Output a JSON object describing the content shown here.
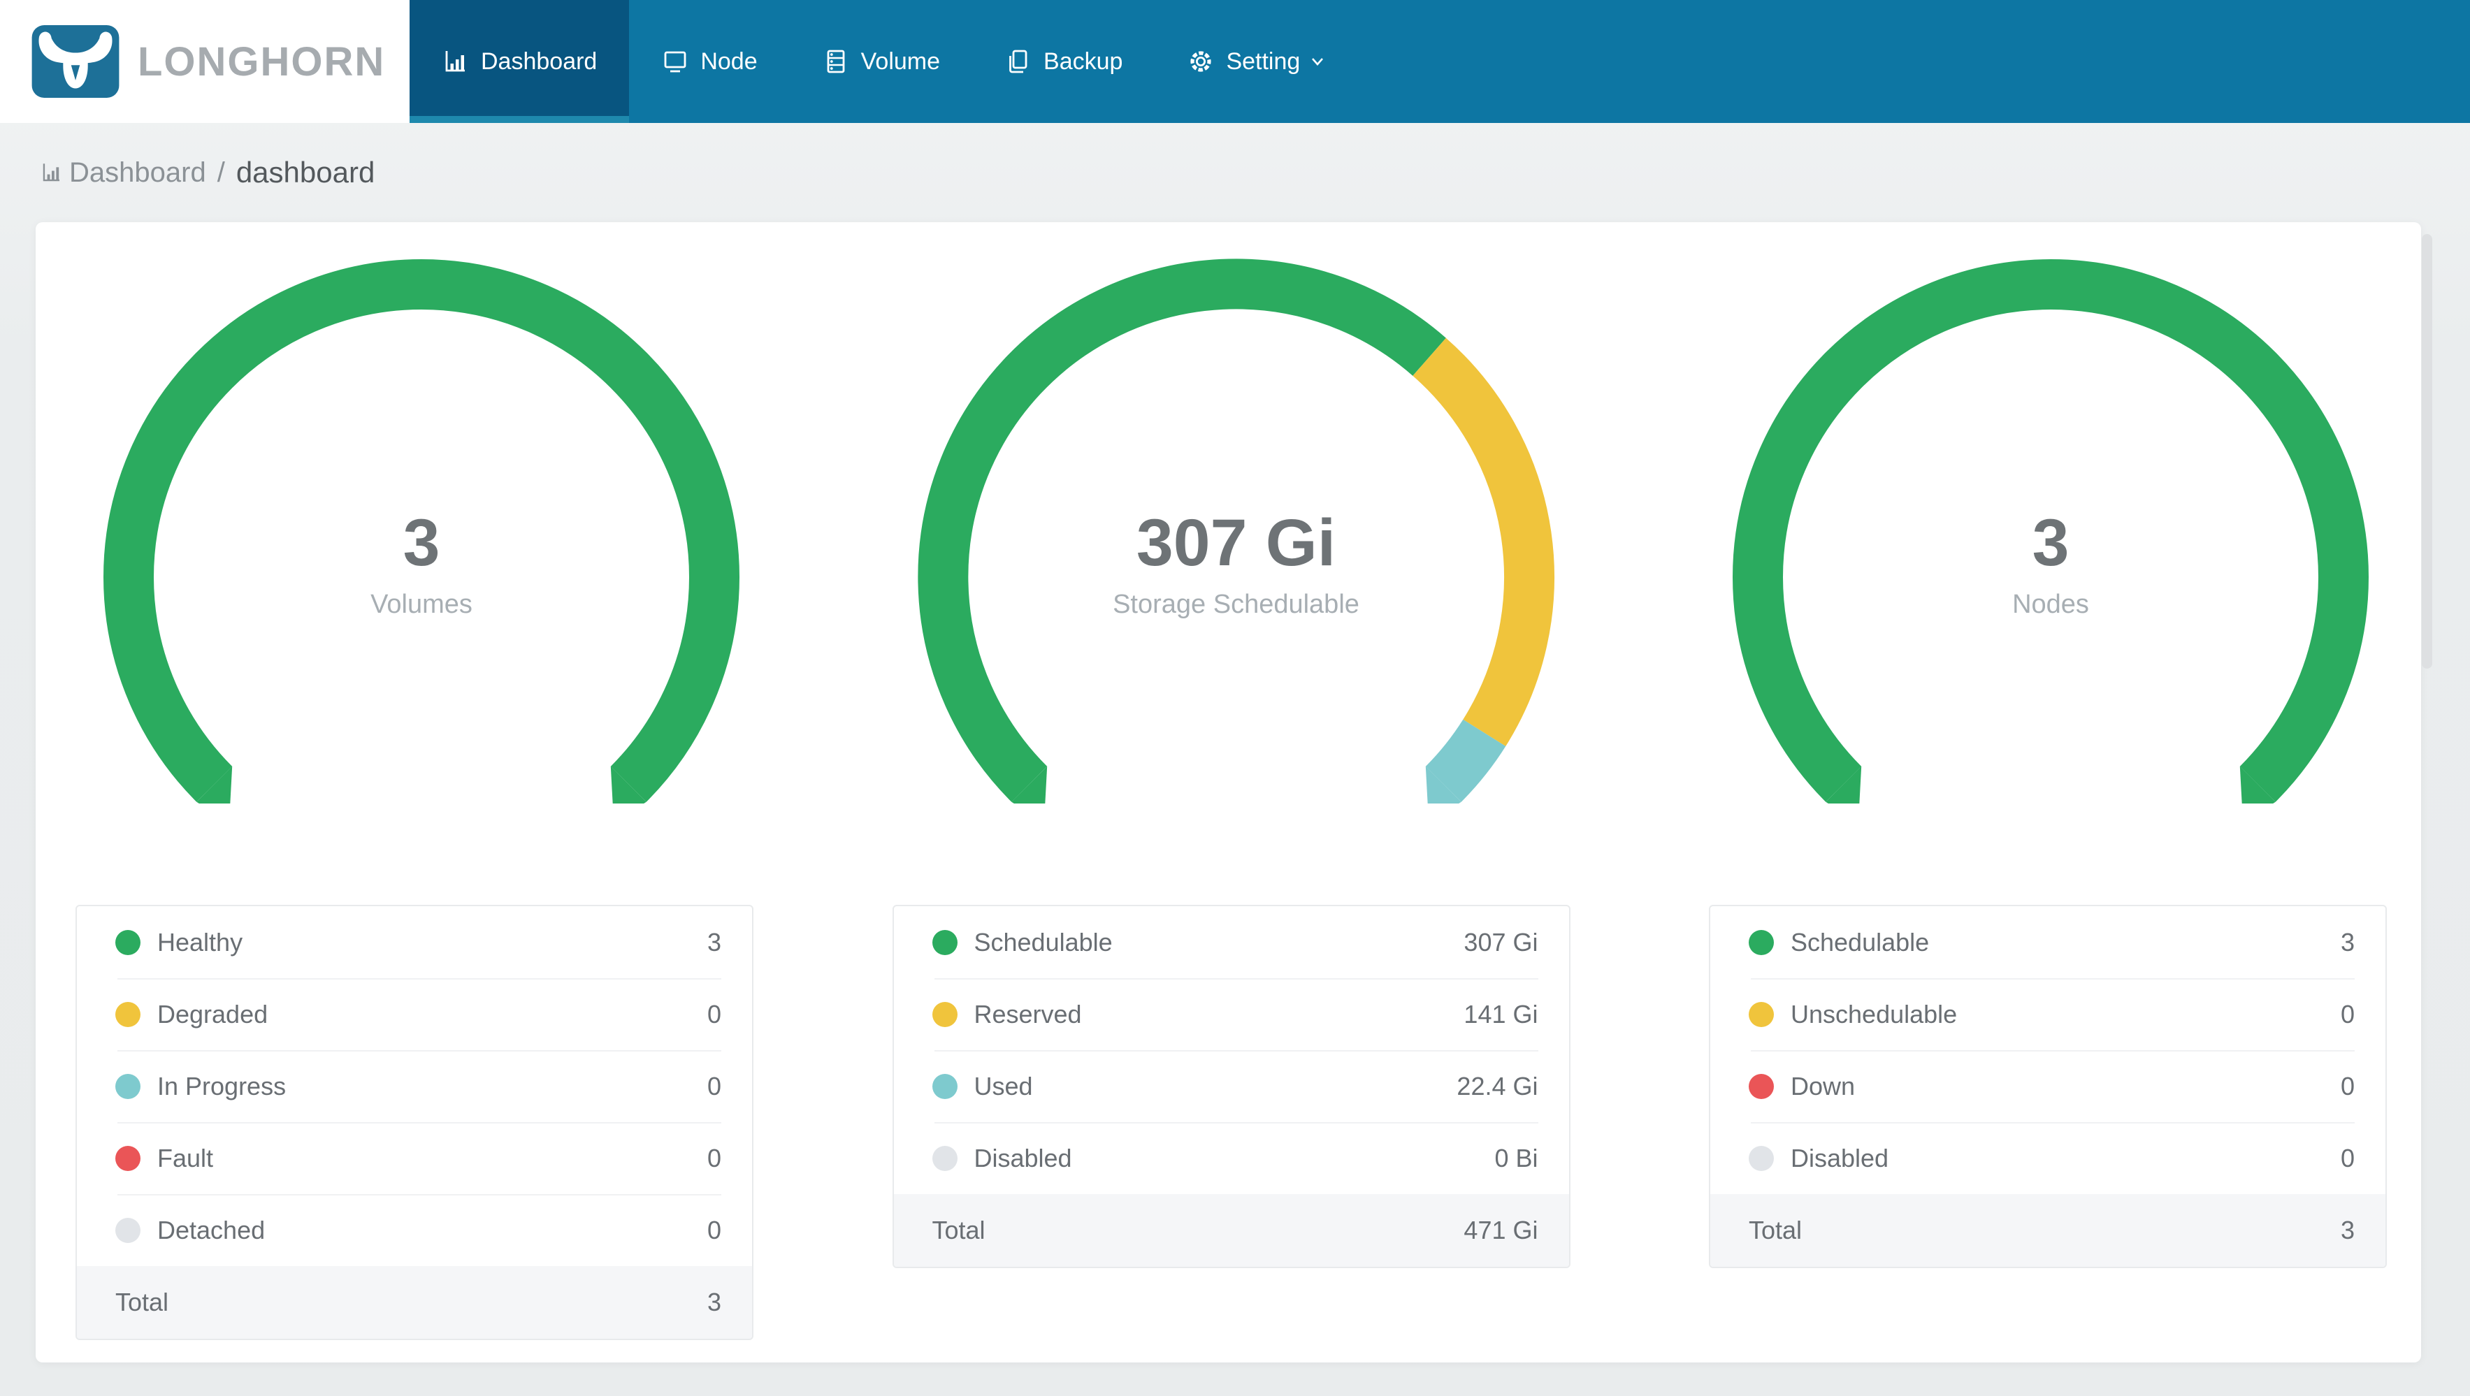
{
  "brand": {
    "name": "LONGHORN"
  },
  "nav": {
    "items": [
      {
        "label": "Dashboard",
        "icon": "bar-chart-icon",
        "active": true
      },
      {
        "label": "Node",
        "icon": "desktop-icon",
        "active": false
      },
      {
        "label": "Volume",
        "icon": "database-icon",
        "active": false
      },
      {
        "label": "Backup",
        "icon": "copy-icon",
        "active": false
      },
      {
        "label": "Setting",
        "icon": "gear-icon",
        "active": false,
        "has_dropdown": true
      }
    ]
  },
  "breadcrumb": {
    "icon": "bar-chart-icon",
    "section": "Dashboard",
    "separator": "/",
    "page": "dashboard"
  },
  "colors": {
    "navbar": "#0d76a3",
    "navbar_active": "#085580",
    "navbar_active_underline": "#1e89ad",
    "logo_blue": "#1d7098",
    "green": "#2bab5f",
    "yellow": "#f0c43c",
    "teal": "#7ecace",
    "red": "#ea5557",
    "gray_dot": "#e1e4e8"
  },
  "chart_data": [
    {
      "type": "gauge",
      "title": "Volumes",
      "center_value": "3",
      "center_label": "Volumes",
      "start_angle": -135,
      "end_angle": 135,
      "total": 3,
      "unit": "",
      "segments": [
        {
          "name": "Healthy",
          "value": 3,
          "color": "#2bab5f"
        },
        {
          "name": "Degraded",
          "value": 0,
          "color": "#f0c43c"
        },
        {
          "name": "In Progress",
          "value": 0,
          "color": "#7ecace"
        },
        {
          "name": "Fault",
          "value": 0,
          "color": "#ea5557"
        },
        {
          "name": "Detached",
          "value": 0,
          "color": "#e1e4e8"
        }
      ]
    },
    {
      "type": "gauge",
      "title": "Storage Schedulable",
      "center_value": "307 Gi",
      "center_label": "Storage Schedulable",
      "start_angle": -135,
      "end_angle": 135,
      "total": 471,
      "unit": "Gi",
      "segments": [
        {
          "name": "Schedulable",
          "value": 307,
          "color": "#2bab5f"
        },
        {
          "name": "Reserved",
          "value": 141,
          "color": "#f0c43c"
        },
        {
          "name": "Used",
          "value": 22.4,
          "color": "#7ecace"
        },
        {
          "name": "Disabled",
          "value": 0,
          "color": "#e1e4e8"
        }
      ]
    },
    {
      "type": "gauge",
      "title": "Nodes",
      "center_value": "3",
      "center_label": "Nodes",
      "start_angle": -135,
      "end_angle": 135,
      "total": 3,
      "unit": "",
      "segments": [
        {
          "name": "Schedulable",
          "value": 3,
          "color": "#2bab5f"
        },
        {
          "name": "Unschedulable",
          "value": 0,
          "color": "#f0c43c"
        },
        {
          "name": "Down",
          "value": 0,
          "color": "#ea5557"
        },
        {
          "name": "Disabled",
          "value": 0,
          "color": "#e1e4e8"
        }
      ]
    }
  ],
  "legend_tables": [
    {
      "rows": [
        {
          "label": "Healthy",
          "value": "3",
          "color": "#2bab5f"
        },
        {
          "label": "Degraded",
          "value": "0",
          "color": "#f0c43c"
        },
        {
          "label": "In Progress",
          "value": "0",
          "color": "#7ecace"
        },
        {
          "label": "Fault",
          "value": "0",
          "color": "#ea5557"
        },
        {
          "label": "Detached",
          "value": "0",
          "color": "#e1e4e8"
        }
      ],
      "total": {
        "label": "Total",
        "value": "3"
      }
    },
    {
      "rows": [
        {
          "label": "Schedulable",
          "value": "307 Gi",
          "color": "#2bab5f"
        },
        {
          "label": "Reserved",
          "value": "141 Gi",
          "color": "#f0c43c"
        },
        {
          "label": "Used",
          "value": "22.4 Gi",
          "color": "#7ecace"
        },
        {
          "label": "Disabled",
          "value": "0 Bi",
          "color": "#e1e4e8"
        }
      ],
      "total": {
        "label": "Total",
        "value": "471 Gi"
      }
    },
    {
      "rows": [
        {
          "label": "Schedulable",
          "value": "3",
          "color": "#2bab5f"
        },
        {
          "label": "Unschedulable",
          "value": "0",
          "color": "#f0c43c"
        },
        {
          "label": "Down",
          "value": "0",
          "color": "#ea5557"
        },
        {
          "label": "Disabled",
          "value": "0",
          "color": "#e1e4e8"
        }
      ],
      "total": {
        "label": "Total",
        "value": "3"
      }
    }
  ]
}
